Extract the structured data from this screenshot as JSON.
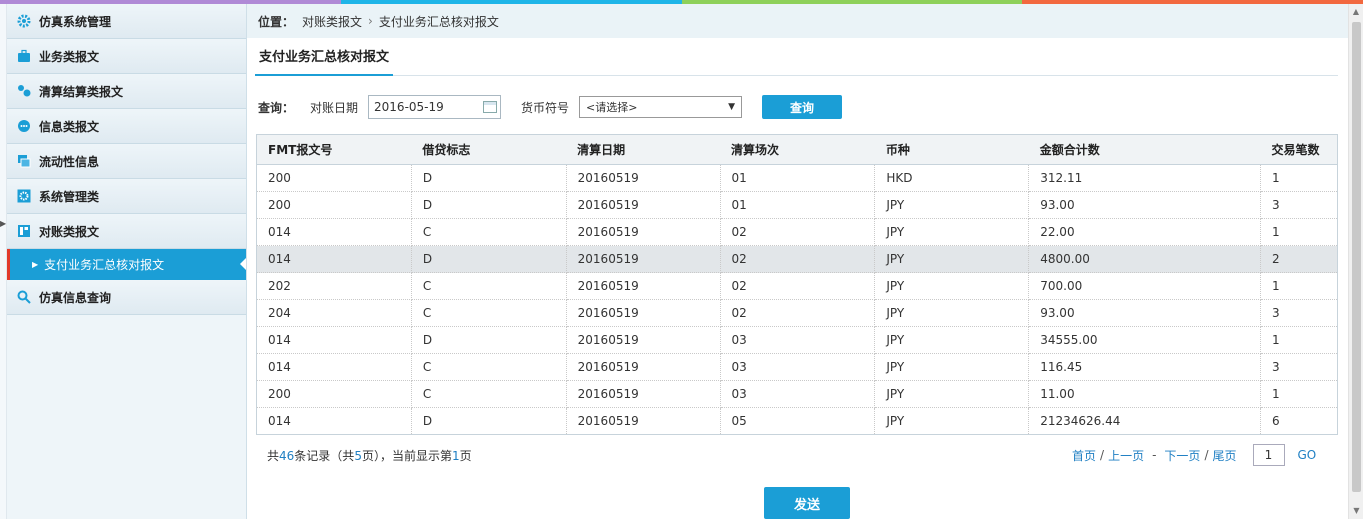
{
  "colors": {
    "accent": "#1b9ed6",
    "active_marker": "#e23a2b",
    "topbar": [
      "#b08ad6",
      "#1fb5e8",
      "#8ed05a",
      "#f2683f"
    ]
  },
  "sidebar": {
    "items": [
      {
        "label": "仿真系统管理",
        "icon": "gear-icon"
      },
      {
        "label": "业务类报文",
        "icon": "briefcase-icon"
      },
      {
        "label": "清算结算类报文",
        "icon": "settlement-icon"
      },
      {
        "label": "信息类报文",
        "icon": "message-icon"
      },
      {
        "label": "流动性信息",
        "icon": "cards-icon"
      },
      {
        "label": "系统管理类",
        "icon": "gear-box-icon"
      },
      {
        "label": "对账类报文",
        "icon": "ledger-icon"
      }
    ],
    "active_sub": "支付业务汇总核对报文",
    "last_item": {
      "label": "仿真信息查询",
      "icon": "magnifier-icon"
    }
  },
  "breadcrumb": {
    "label": "位置：",
    "parts": [
      "对账类报文",
      "支付业务汇总核对报文"
    ]
  },
  "page_title": "支付业务汇总核对报文",
  "query": {
    "label": "查询：",
    "date_label": "对账日期",
    "date_value": "2016-05-19",
    "currency_label": "货币符号",
    "currency_value": "<请选择>",
    "button": "查询"
  },
  "table": {
    "headers": [
      "FMT报文号",
      "借贷标志",
      "清算日期",
      "清算场次",
      "币种",
      "金额合计数",
      "交易笔数"
    ],
    "rows": [
      [
        "200",
        "D",
        "20160519",
        "01",
        "HKD",
        "312.11",
        "1"
      ],
      [
        "200",
        "D",
        "20160519",
        "01",
        "JPY",
        "93.00",
        "3"
      ],
      [
        "014",
        "C",
        "20160519",
        "02",
        "JPY",
        "22.00",
        "1"
      ],
      [
        "014",
        "D",
        "20160519",
        "02",
        "JPY",
        "4800.00",
        "2"
      ],
      [
        "202",
        "C",
        "20160519",
        "02",
        "JPY",
        "700.00",
        "1"
      ],
      [
        "204",
        "C",
        "20160519",
        "02",
        "JPY",
        "93.00",
        "3"
      ],
      [
        "014",
        "D",
        "20160519",
        "03",
        "JPY",
        "34555.00",
        "1"
      ],
      [
        "014",
        "C",
        "20160519",
        "03",
        "JPY",
        "116.45",
        "3"
      ],
      [
        "200",
        "C",
        "20160519",
        "03",
        "JPY",
        "11.00",
        "1"
      ],
      [
        "014",
        "D",
        "20160519",
        "05",
        "JPY",
        "21234626.44",
        "6"
      ]
    ],
    "highlighted_row": 3
  },
  "pager": {
    "t1": "共",
    "total": "46",
    "t2": "条记录（共",
    "pages": "5",
    "t3": "页），当前显示第",
    "current": "1",
    "t4": "页",
    "first": "首页",
    "prev": "上一页",
    "dash": "-",
    "next": "下一页",
    "last": "尾页",
    "slash": "/",
    "page_input": "1",
    "go": "GO"
  },
  "send_button": "发送"
}
